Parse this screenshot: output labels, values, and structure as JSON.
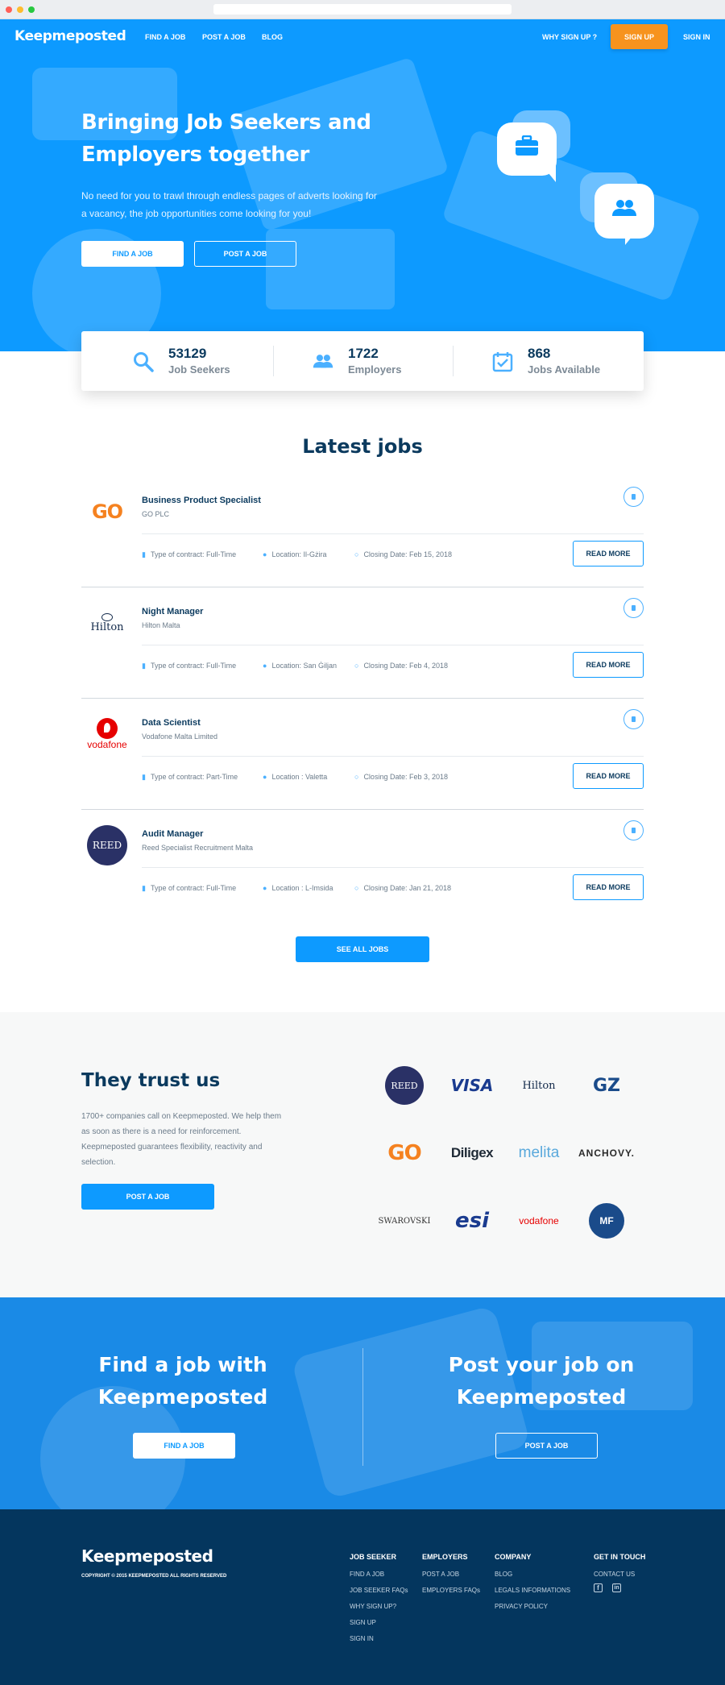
{
  "brand": {
    "name": "Keepmeposted",
    "accent": "#0d9aff",
    "orange": "#f7931e",
    "navy": "#04365e"
  },
  "nav": {
    "find_job": "FIND A JOB",
    "post_job": "POST A JOB",
    "blog": "BLOG",
    "why": "WHY SIGN UP ?",
    "signup": "SIGN UP",
    "signin": "SIGN IN"
  },
  "hero": {
    "title": "Bringing Job Seekers and Employers together",
    "text": "No need for you to trawl through endless pages of adverts looking for a vacancy, the job opportunities come looking for you!",
    "find_btn": "FIND A JOB",
    "post_btn": "POST A JOB",
    "icons": [
      "briefcase-icon",
      "users-icon"
    ]
  },
  "stats": [
    {
      "number": "53129",
      "label": "Job Seekers",
      "icon": "search-icon"
    },
    {
      "number": "1722",
      "label": "Employers",
      "icon": "users-icon"
    },
    {
      "number": "868",
      "label": "Jobs Available",
      "icon": "calendar-check-icon"
    }
  ],
  "latest": {
    "heading": "Latest jobs",
    "contract_prefix": "Type of contract:",
    "read_more": "READ MORE",
    "see_all": "SEE ALL JOBS",
    "jobs": [
      {
        "title": "Business Product Specialist",
        "company": "GO PLC",
        "contract": "Type of contract: Full-Time",
        "location": "Location: Il-Gżira",
        "closing": "Closing Date: Feb 15, 2018",
        "logo": "GO"
      },
      {
        "title": "Night Manager",
        "company": "Hilton Malta",
        "contract": "Type of contract: Full-Time",
        "location": "Location: San Ġiljan",
        "closing": "Closing Date: Feb 4, 2018",
        "logo": "Hilton"
      },
      {
        "title": "Data Scientist",
        "company": "Vodafone Malta Limited",
        "contract": "Type of contract: Part-Time",
        "location": "Location : Valetta",
        "closing": "Closing Date: Feb 3, 2018",
        "logo": "vodafone"
      },
      {
        "title": "Audit Manager",
        "company": "Reed Specialist Recruitment Malta",
        "contract": "Type of contract: Full-Time",
        "location": "Location : L-Imsida",
        "closing": "Closing Date: Jan 21, 2018",
        "logo": "REED"
      }
    ]
  },
  "trust": {
    "heading": "They trust us",
    "text": "1700+ companies call on Keepmeposted. We help them as soon as there is a need for reinforcement. Keepmeposted guarantees flexibility, reactivity and selection.",
    "button": "POST A JOB",
    "logos": [
      "REED",
      "VISA",
      "Hilton",
      "GZ",
      "GO",
      "Diligex",
      "melita",
      "ANCHOVY.",
      "SWAROVSKI",
      "esi",
      "vodafone",
      "MF"
    ]
  },
  "cta": {
    "left_title": "Find a job with Keepmeposted",
    "left_btn": "FIND A JOB",
    "right_title": "Post your job on Keepmeposted",
    "right_btn": "POST A JOB"
  },
  "footer": {
    "logo": "Keepmeposted",
    "copyright": "COPYRIGHT © 2015 KEEPMEPOSTED ALL RIGHTS RESERVED",
    "job_seeker": {
      "heading": "JOB SEEKER",
      "links": [
        "FIND A JOB",
        "JOB SEEKER FAQs",
        "WHY SIGN UP?",
        "SIGN UP",
        "SIGN IN"
      ]
    },
    "employers": {
      "heading": "EMPLOYERS",
      "links": [
        "POST A JOB",
        "EMPLOYERS FAQs"
      ]
    },
    "company": {
      "heading": "COMPANY",
      "links": [
        "BLOG",
        "LEGALS INFORMATIONS",
        "PRIVACY POLICY"
      ]
    },
    "touch": {
      "heading": "GET IN TOUCH",
      "links": [
        "CONTACT US"
      ],
      "social": [
        "facebook-icon",
        "linkedin-icon"
      ]
    }
  }
}
